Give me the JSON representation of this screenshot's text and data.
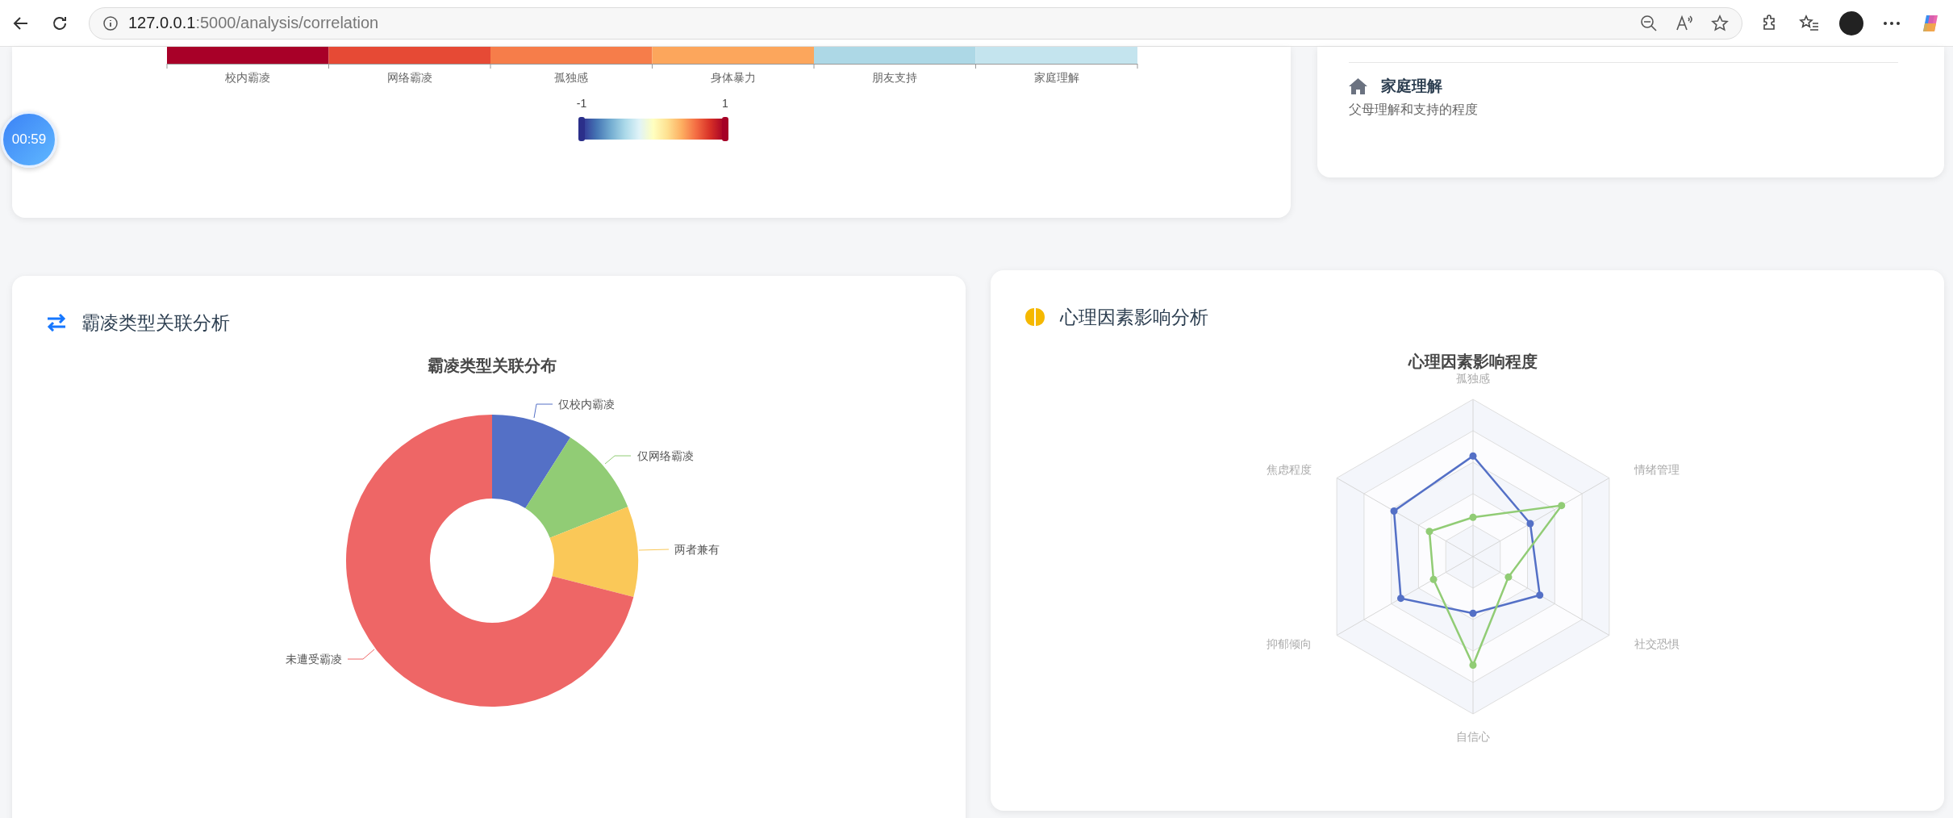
{
  "browser": {
    "url_host": "127.0.0.1",
    "url_path": ":5000/analysis/correlation"
  },
  "timer": {
    "label": "00:59"
  },
  "heatmap": {
    "cells": [
      {
        "label": "校内霸凌",
        "color": "#a80028"
      },
      {
        "label": "网络霸凌",
        "color": "#e64a35"
      },
      {
        "label": "孤独感",
        "color": "#f67d4a"
      },
      {
        "label": "身体暴力",
        "color": "#fca65c"
      },
      {
        "label": "朋友支持",
        "color": "#add8e6"
      },
      {
        "label": "家庭理解",
        "color": "#c4e4ee"
      }
    ],
    "scale": {
      "min_label": "-1",
      "max_label": "1",
      "handles": [
        {
          "level": 0
        },
        {
          "level": 1
        }
      ]
    }
  },
  "factor_card": {
    "items": [
      {
        "title": "家庭理解",
        "description": "父母理解和支持的程度"
      }
    ]
  },
  "bullying_card": {
    "title": "霸凌类型关联分析",
    "chart": {
      "title": "霸凌类型关联分布",
      "slices": [
        {
          "label": "仅校内霸凌",
          "color": "#5470c6"
        },
        {
          "label": "仅网络霸凌",
          "color": "#91cc75"
        },
        {
          "label": "两者兼有",
          "color": "#fac858"
        },
        {
          "label": "未遭受霸凌",
          "color": "#ee6666"
        }
      ]
    }
  },
  "psych_card": {
    "title": "心理因素影响分析",
    "chart": {
      "title": "心理因素影响程度",
      "axes": [
        "孤独感",
        "情绪管理",
        "社交恐惧",
        "自信心",
        "抑郁倾向",
        "焦虑程度"
      ],
      "series": [
        {
          "color": "#5470c6"
        },
        {
          "color": "#91cc75"
        }
      ]
    }
  }
}
